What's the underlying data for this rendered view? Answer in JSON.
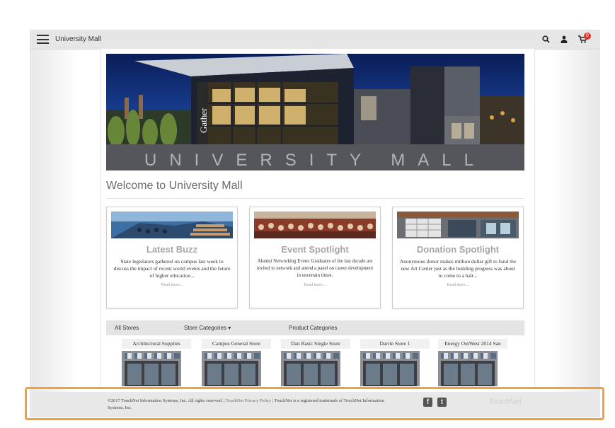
{
  "header": {
    "brand": "University Mall",
    "icons": [
      "menu-icon",
      "search-icon",
      "user-icon",
      "cart-icon"
    ],
    "cart_count": "0"
  },
  "banner": {
    "sign_text": "Gather",
    "title": "UNIVERSITY MALL"
  },
  "welcome": "Welcome to University Mall",
  "cards": [
    {
      "title": "Latest Buzz",
      "text": "State legislators gathered on campus last week to discuss the impact of recent world events and the future of higher education...",
      "more": "Read more..."
    },
    {
      "title": "Event Spotlight",
      "text": "Alumni Networking Event: Graduates of the last decade are invited to network and attend a panel on career development in uncertain times.",
      "more": "Read more..."
    },
    {
      "title": "Donation Spotlight",
      "text": "Anonymous donor makes million dollar gift to fund the new Art Center just as the building progress was about to come to a halt...",
      "more": "Read more..."
    }
  ],
  "store_nav": {
    "all_stores": "All Stores",
    "store_categories": "Store Categories",
    "product_categories": "Product Categories"
  },
  "stores": [
    "Architectural Supplies",
    "Campus General Store",
    "Dan Basic Single Store",
    "Darrin Store 1",
    "Energy OutWest 2014 San"
  ],
  "footer": {
    "copyright": "©2017 TouchNet Information Systems, Inc. All rights reserved.",
    "privacy_link": "TouchNet Privacy Policy",
    "trademark": "TouchNet is a registered trademark of TouchNet Information Systems, Inc.",
    "logo": "TouchNet"
  },
  "colors": {
    "highlight": "#f0a23a",
    "cart_badge": "#e2352f",
    "card_title": "#a6a6a6"
  }
}
